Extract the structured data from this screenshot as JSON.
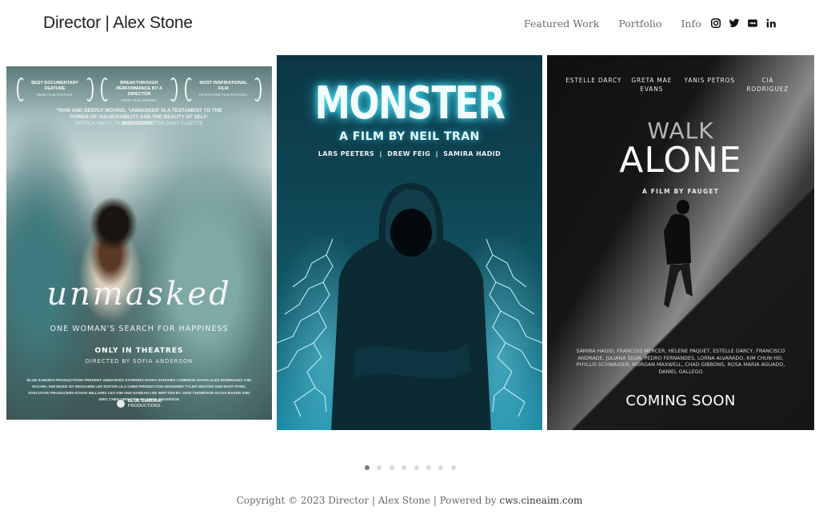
{
  "header": {
    "site_title": "Director | Alex Stone",
    "nav": [
      {
        "label": "Featured Work"
      },
      {
        "label": "Portfolio"
      },
      {
        "label": "Info"
      }
    ],
    "social": [
      {
        "name": "instagram",
        "icon": "instagram-icon"
      },
      {
        "name": "twitter",
        "icon": "twitter-icon"
      },
      {
        "name": "imdb",
        "icon": "imdb-icon"
      },
      {
        "name": "linkedin",
        "icon": "linkedin-icon"
      }
    ]
  },
  "carousel": {
    "posters": [
      {
        "title": "unmasked",
        "awards": [
          {
            "award": "BEST DOCUMENTARY FEATURE",
            "festival": "INDIE FILM FESTIVAL"
          },
          {
            "award": "BREAKTHROUGH PERFORMANCE BY A DIRECTOR",
            "festival": "INDIE FILM AWARDS"
          },
          {
            "award": "MOST INSPIRATIONAL FILM",
            "festival": "HEARTLAND FILM FESTIVAL"
          }
        ],
        "quote": "\"RAW AND DEEPLY MOVING, 'UNMASKED' IS A TESTAMENT TO THE POWER OF VULNERABILITY AND THE BEAUTY OF SELF-DISCOVERY.\"",
        "quote_by": "PATRICK SMITH, FILM CRITIC FOR THE DAILY GAZETTE",
        "tagline": "ONE WOMAN'S SEARCH FOR HAPPINESS",
        "release": "ONLY IN THEATRES",
        "director": "DIRECTED BY SOFIA ANDERSON",
        "credits": "BLUE SAMURAI PRODUCTIONS PRESENT UNMASKED STARRING MARIA SANCHEZ CAMERON HAYES ALEX RODRIGUEZ AND RACHEL KIM MUSIC BY BENJAMIN LEE EDITOR LILA CHEN PRODUCTION DESIGNER TYLER NGUYEN AND MAYA PATEL EXECUTIVE PRODUCERS ETHAN WILLIAMS LEO KIM AND HANNAH LEE WRITTEN BY JAKE THOMPSON OLIVIA BAKER AND ERIC CHEN DIRECTED BY SOFIA ANDERSON",
        "studio_line1": "BLUE SAMURAI",
        "studio_line2": "PRODUCTIONS"
      },
      {
        "title": "MONSTER",
        "subtitle": "A FILM BY NEIL TRAN",
        "cast": "LARS PEETERS  |  DREW FEIG  |  SAMIRA HADID"
      },
      {
        "cast": [
          "ESTELLE DARCY",
          "GRETA MAE EVANS",
          "YANIS PETROS",
          "CIA RODRIGUEZ"
        ],
        "title_line1": "WALK",
        "title_line2": "ALONE",
        "subtitle": "A FILM BY FAUGET",
        "credits": "SAMIRA HADID, FRANCOIS MERCER, HELENE PAQUET, ESTELLE DARCY, FRANCISCO ANDRADE, JULIANA SILVA, PEDRO FERNANDES, LORNA ALVARADO, KIM CHUN HEI, PHYLLIS SCHWAIGER, MORGAN MAXWELL, CHAD GIBBONS, ROSA MARIA AGUADO, DANIEL GALLEGO",
        "status": "COMING SOON"
      }
    ],
    "total_slides": 8,
    "active_slide": 1
  },
  "footer": {
    "text": "Copyright © 2023 Director | Alex Stone | Powered by ",
    "link": "cws.cineaim.com"
  }
}
